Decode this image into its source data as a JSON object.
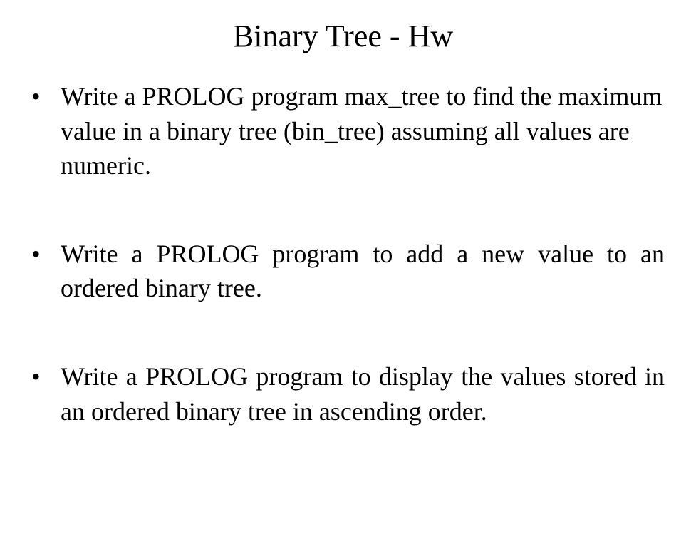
{
  "title": "Binary Tree - Hw",
  "bullets": [
    {
      "text": "Write a PROLOG program max_tree to find the maximum value in a binary tree (bin_tree) assuming all values are numeric."
    },
    {
      "text": "Write a PROLOG program to add a new value to an ordered binary tree."
    },
    {
      "text": "Write a PROLOG program to display the values stored in an ordered binary tree in ascending order."
    }
  ]
}
